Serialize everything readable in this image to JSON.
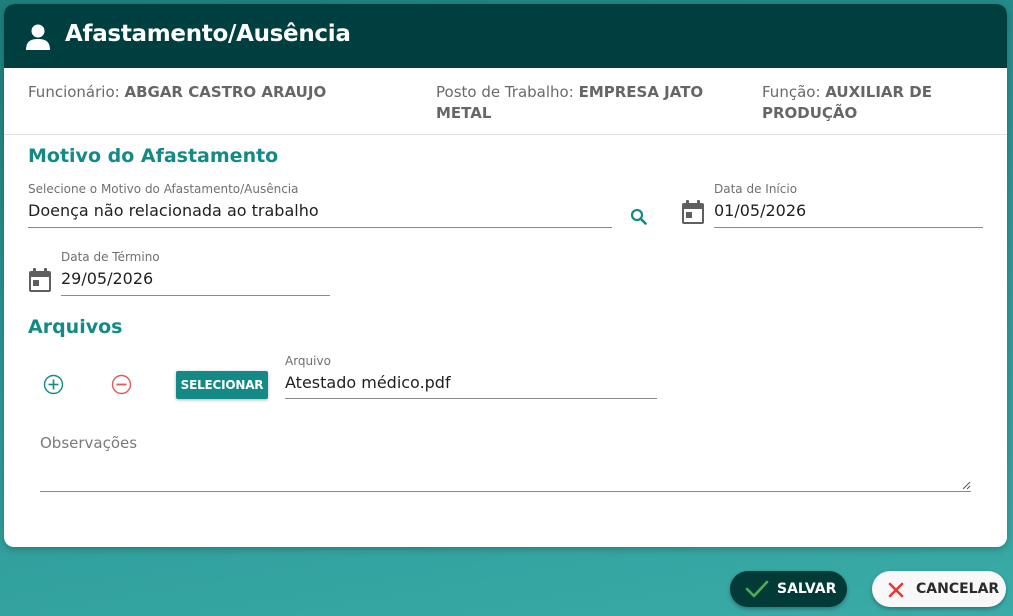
{
  "header": {
    "title": "Afastamento/Ausência",
    "icon": "user-icon"
  },
  "info": {
    "employee_label": "Funcionário:",
    "employee_value": "ABGAR CASTRO ARAUJO",
    "post_label": "Posto de Trabalho:",
    "post_value": "EMPRESA JATO METAL",
    "role_label": "Função:",
    "role_value": "AUXILIAR DE PRODUÇÃO"
  },
  "reason_section": {
    "title": "Motivo do Afastamento",
    "reason_label": "Selecione o Motivo do Afastamento/Ausência",
    "reason_value": "Doença não relacionada ao trabalho",
    "start_label": "Data de Início",
    "start_value": "01/05/2026",
    "end_label": "Data de Término",
    "end_value": "29/05/2026"
  },
  "files_section": {
    "title": "Arquivos",
    "select_button": "SELECIONAR",
    "file_label": "Arquivo",
    "file_value": "Atestado médico.pdf",
    "notes_placeholder": "Observações"
  },
  "footer": {
    "save_label": "SALVAR",
    "cancel_label": "CANCELAR"
  },
  "colors": {
    "header_bg": "#003f3f",
    "accent": "#138a85",
    "remove": "#e05a5a",
    "save_check": "#4caf50",
    "cancel_x": "#e53935"
  }
}
